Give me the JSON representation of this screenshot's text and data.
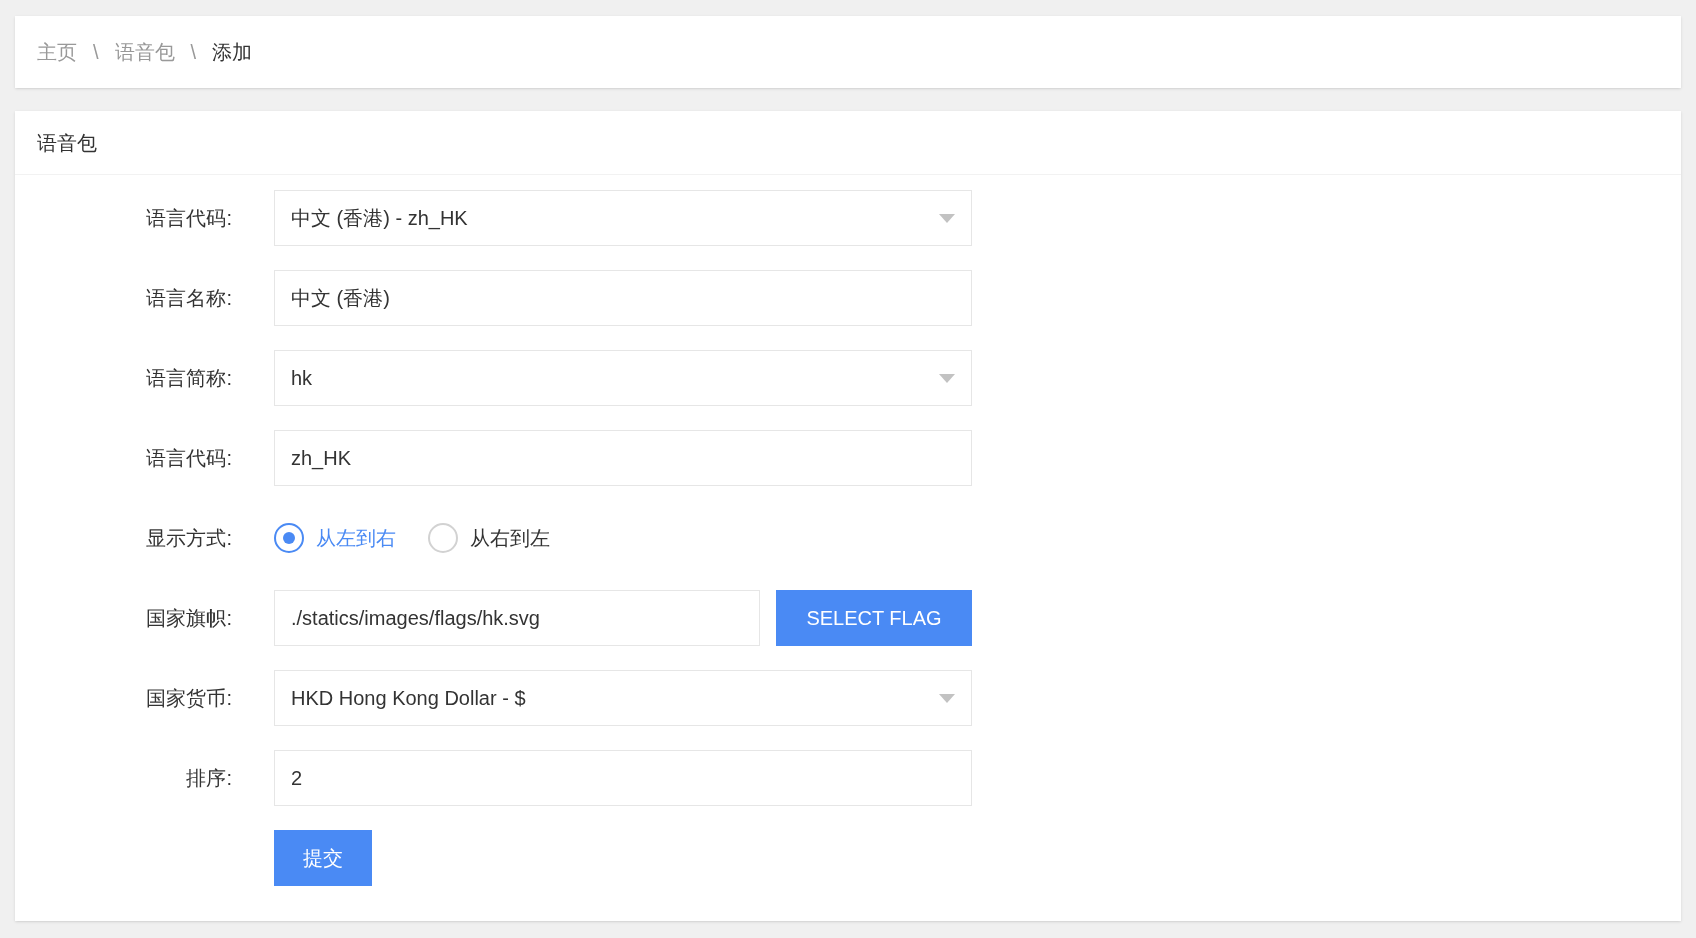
{
  "breadcrumb": [
    {
      "label": "主页",
      "separator": "\\"
    },
    {
      "label": "语音包",
      "separator": "\\"
    },
    {
      "label": "添加"
    }
  ],
  "card": {
    "title": "语音包"
  },
  "fields": [
    {
      "kind": "select",
      "label": "语言代码:",
      "value": "中文 (香港) - zh_HK"
    },
    {
      "kind": "text",
      "label": "语言名称:",
      "value": "中文 (香港)"
    },
    {
      "kind": "select",
      "label": "语言简称:",
      "value": "hk"
    },
    {
      "kind": "text",
      "label": "语言代码:",
      "value": "zh_HK"
    },
    {
      "kind": "radio",
      "label": "显示方式:",
      "options": [
        {
          "label": "从左到右",
          "selected": true
        },
        {
          "label": "从右到左",
          "selected": false
        }
      ]
    },
    {
      "kind": "file",
      "label": "国家旗帜:",
      "value": "./statics/images/flags/hk.svg",
      "button": "SELECT FLAG"
    },
    {
      "kind": "select",
      "label": "国家货币:",
      "value": "HKD Hong Kong Dollar - $"
    },
    {
      "kind": "text",
      "label": "排序:",
      "value": "2"
    }
  ],
  "submit": "提交"
}
